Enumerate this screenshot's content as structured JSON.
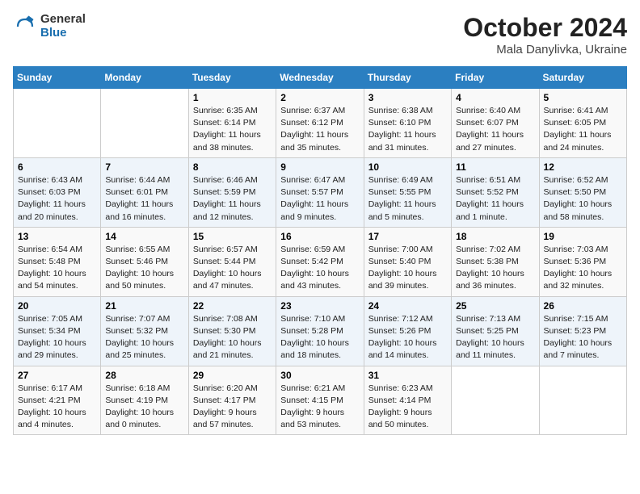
{
  "logo": {
    "general": "General",
    "blue": "Blue"
  },
  "title": "October 2024",
  "subtitle": "Mala Danylivka, Ukraine",
  "days_header": [
    "Sunday",
    "Monday",
    "Tuesday",
    "Wednesday",
    "Thursday",
    "Friday",
    "Saturday"
  ],
  "weeks": [
    [
      {
        "num": "",
        "info": ""
      },
      {
        "num": "",
        "info": ""
      },
      {
        "num": "1",
        "info": "Sunrise: 6:35 AM\nSunset: 6:14 PM\nDaylight: 11 hours and 38 minutes."
      },
      {
        "num": "2",
        "info": "Sunrise: 6:37 AM\nSunset: 6:12 PM\nDaylight: 11 hours and 35 minutes."
      },
      {
        "num": "3",
        "info": "Sunrise: 6:38 AM\nSunset: 6:10 PM\nDaylight: 11 hours and 31 minutes."
      },
      {
        "num": "4",
        "info": "Sunrise: 6:40 AM\nSunset: 6:07 PM\nDaylight: 11 hours and 27 minutes."
      },
      {
        "num": "5",
        "info": "Sunrise: 6:41 AM\nSunset: 6:05 PM\nDaylight: 11 hours and 24 minutes."
      }
    ],
    [
      {
        "num": "6",
        "info": "Sunrise: 6:43 AM\nSunset: 6:03 PM\nDaylight: 11 hours and 20 minutes."
      },
      {
        "num": "7",
        "info": "Sunrise: 6:44 AM\nSunset: 6:01 PM\nDaylight: 11 hours and 16 minutes."
      },
      {
        "num": "8",
        "info": "Sunrise: 6:46 AM\nSunset: 5:59 PM\nDaylight: 11 hours and 12 minutes."
      },
      {
        "num": "9",
        "info": "Sunrise: 6:47 AM\nSunset: 5:57 PM\nDaylight: 11 hours and 9 minutes."
      },
      {
        "num": "10",
        "info": "Sunrise: 6:49 AM\nSunset: 5:55 PM\nDaylight: 11 hours and 5 minutes."
      },
      {
        "num": "11",
        "info": "Sunrise: 6:51 AM\nSunset: 5:52 PM\nDaylight: 11 hours and 1 minute."
      },
      {
        "num": "12",
        "info": "Sunrise: 6:52 AM\nSunset: 5:50 PM\nDaylight: 10 hours and 58 minutes."
      }
    ],
    [
      {
        "num": "13",
        "info": "Sunrise: 6:54 AM\nSunset: 5:48 PM\nDaylight: 10 hours and 54 minutes."
      },
      {
        "num": "14",
        "info": "Sunrise: 6:55 AM\nSunset: 5:46 PM\nDaylight: 10 hours and 50 minutes."
      },
      {
        "num": "15",
        "info": "Sunrise: 6:57 AM\nSunset: 5:44 PM\nDaylight: 10 hours and 47 minutes."
      },
      {
        "num": "16",
        "info": "Sunrise: 6:59 AM\nSunset: 5:42 PM\nDaylight: 10 hours and 43 minutes."
      },
      {
        "num": "17",
        "info": "Sunrise: 7:00 AM\nSunset: 5:40 PM\nDaylight: 10 hours and 39 minutes."
      },
      {
        "num": "18",
        "info": "Sunrise: 7:02 AM\nSunset: 5:38 PM\nDaylight: 10 hours and 36 minutes."
      },
      {
        "num": "19",
        "info": "Sunrise: 7:03 AM\nSunset: 5:36 PM\nDaylight: 10 hours and 32 minutes."
      }
    ],
    [
      {
        "num": "20",
        "info": "Sunrise: 7:05 AM\nSunset: 5:34 PM\nDaylight: 10 hours and 29 minutes."
      },
      {
        "num": "21",
        "info": "Sunrise: 7:07 AM\nSunset: 5:32 PM\nDaylight: 10 hours and 25 minutes."
      },
      {
        "num": "22",
        "info": "Sunrise: 7:08 AM\nSunset: 5:30 PM\nDaylight: 10 hours and 21 minutes."
      },
      {
        "num": "23",
        "info": "Sunrise: 7:10 AM\nSunset: 5:28 PM\nDaylight: 10 hours and 18 minutes."
      },
      {
        "num": "24",
        "info": "Sunrise: 7:12 AM\nSunset: 5:26 PM\nDaylight: 10 hours and 14 minutes."
      },
      {
        "num": "25",
        "info": "Sunrise: 7:13 AM\nSunset: 5:25 PM\nDaylight: 10 hours and 11 minutes."
      },
      {
        "num": "26",
        "info": "Sunrise: 7:15 AM\nSunset: 5:23 PM\nDaylight: 10 hours and 7 minutes."
      }
    ],
    [
      {
        "num": "27",
        "info": "Sunrise: 6:17 AM\nSunset: 4:21 PM\nDaylight: 10 hours and 4 minutes."
      },
      {
        "num": "28",
        "info": "Sunrise: 6:18 AM\nSunset: 4:19 PM\nDaylight: 10 hours and 0 minutes."
      },
      {
        "num": "29",
        "info": "Sunrise: 6:20 AM\nSunset: 4:17 PM\nDaylight: 9 hours and 57 minutes."
      },
      {
        "num": "30",
        "info": "Sunrise: 6:21 AM\nSunset: 4:15 PM\nDaylight: 9 hours and 53 minutes."
      },
      {
        "num": "31",
        "info": "Sunrise: 6:23 AM\nSunset: 4:14 PM\nDaylight: 9 hours and 50 minutes."
      },
      {
        "num": "",
        "info": ""
      },
      {
        "num": "",
        "info": ""
      }
    ]
  ]
}
